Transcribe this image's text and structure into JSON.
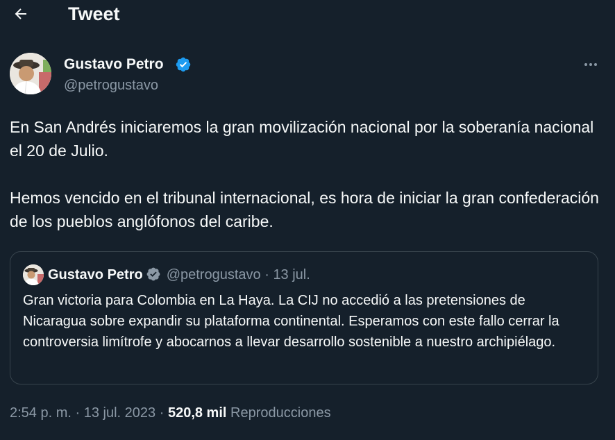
{
  "header": {
    "title": "Tweet",
    "back_icon": "arrow-left-icon"
  },
  "author": {
    "display_name": "Gustavo Petro",
    "handle": "@petrogustavo",
    "verified_icon": "verified-badge-icon",
    "more_icon": "more-horizontal-icon"
  },
  "tweet": {
    "paragraph_1": "En San Andrés iniciaremos la gran movilización nacional por la soberanía nacional el 20 de Julio.",
    "paragraph_2": "Hemos vencido en el tribunal internacional, es hora de iniciar la gran confederación de los pueblos anglófonos del caribe."
  },
  "quoted_tweet": {
    "display_name": "Gustavo Petro",
    "handle": "@petrogustavo",
    "separator": "·",
    "date": "13 jul.",
    "text": "Gran victoria para Colombia en La Haya. La CIJ no accedió a las pretensiones de Nicaragua sobre expandir su plataforma continental. Esperamos con este fallo cerrar la controversia limítrofe y abocarnos a llevar desarrollo sostenible a nuestro archipiélago."
  },
  "footer": {
    "time": "2:54 p. m.",
    "separator_1": "·",
    "date": "13 jul. 2023",
    "separator_2": "·",
    "views_count": "520,8 mil",
    "views_label": "Reproducciones"
  },
  "colors": {
    "background": "#15202b",
    "text_primary": "#f7f9f9",
    "text_secondary": "#8b98a5",
    "border": "#38444d",
    "verified_blue": "#1d9bf0"
  }
}
